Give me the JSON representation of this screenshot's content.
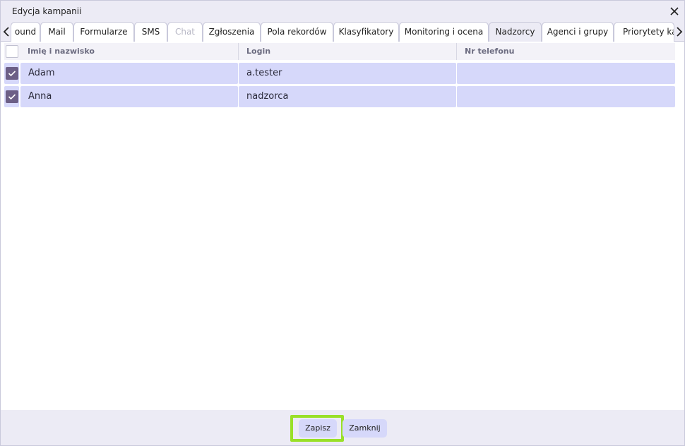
{
  "window": {
    "title": "Edycja kampanii",
    "close_icon": "close-icon"
  },
  "tabs": {
    "prev_icon": "chevron-left-icon",
    "next_icon": "chevron-right-icon",
    "items": [
      {
        "label": "ound",
        "state": "normal"
      },
      {
        "label": "Mail",
        "state": "normal"
      },
      {
        "label": "Formularze",
        "state": "normal"
      },
      {
        "label": "SMS",
        "state": "normal"
      },
      {
        "label": "Chat",
        "state": "disabled"
      },
      {
        "label": "Zgłoszenia",
        "state": "normal"
      },
      {
        "label": "Pola rekordów",
        "state": "normal"
      },
      {
        "label": "Klasyfikatory",
        "state": "normal"
      },
      {
        "label": "Monitoring i ocena",
        "state": "normal"
      },
      {
        "label": "Nadzorcy",
        "state": "active"
      },
      {
        "label": "Agenci i grupy",
        "state": "normal"
      },
      {
        "label": "Priorytety kar",
        "state": "normal"
      }
    ]
  },
  "table": {
    "columns": [
      "Imię i nazwisko",
      "Login",
      "Nr telefonu"
    ],
    "rows": [
      {
        "checked": true,
        "name": "Adam",
        "login": "a.tester",
        "phone": ""
      },
      {
        "checked": true,
        "name": "Anna",
        "login": "nadzorca",
        "phone": ""
      }
    ]
  },
  "footer": {
    "save_label": "Zapisz",
    "close_label": "Zamknij"
  },
  "colors": {
    "accent": "#d6d8fa",
    "checkbox": "#6c5f86",
    "highlight": "#99e028",
    "chrome": "#ecebf5"
  }
}
